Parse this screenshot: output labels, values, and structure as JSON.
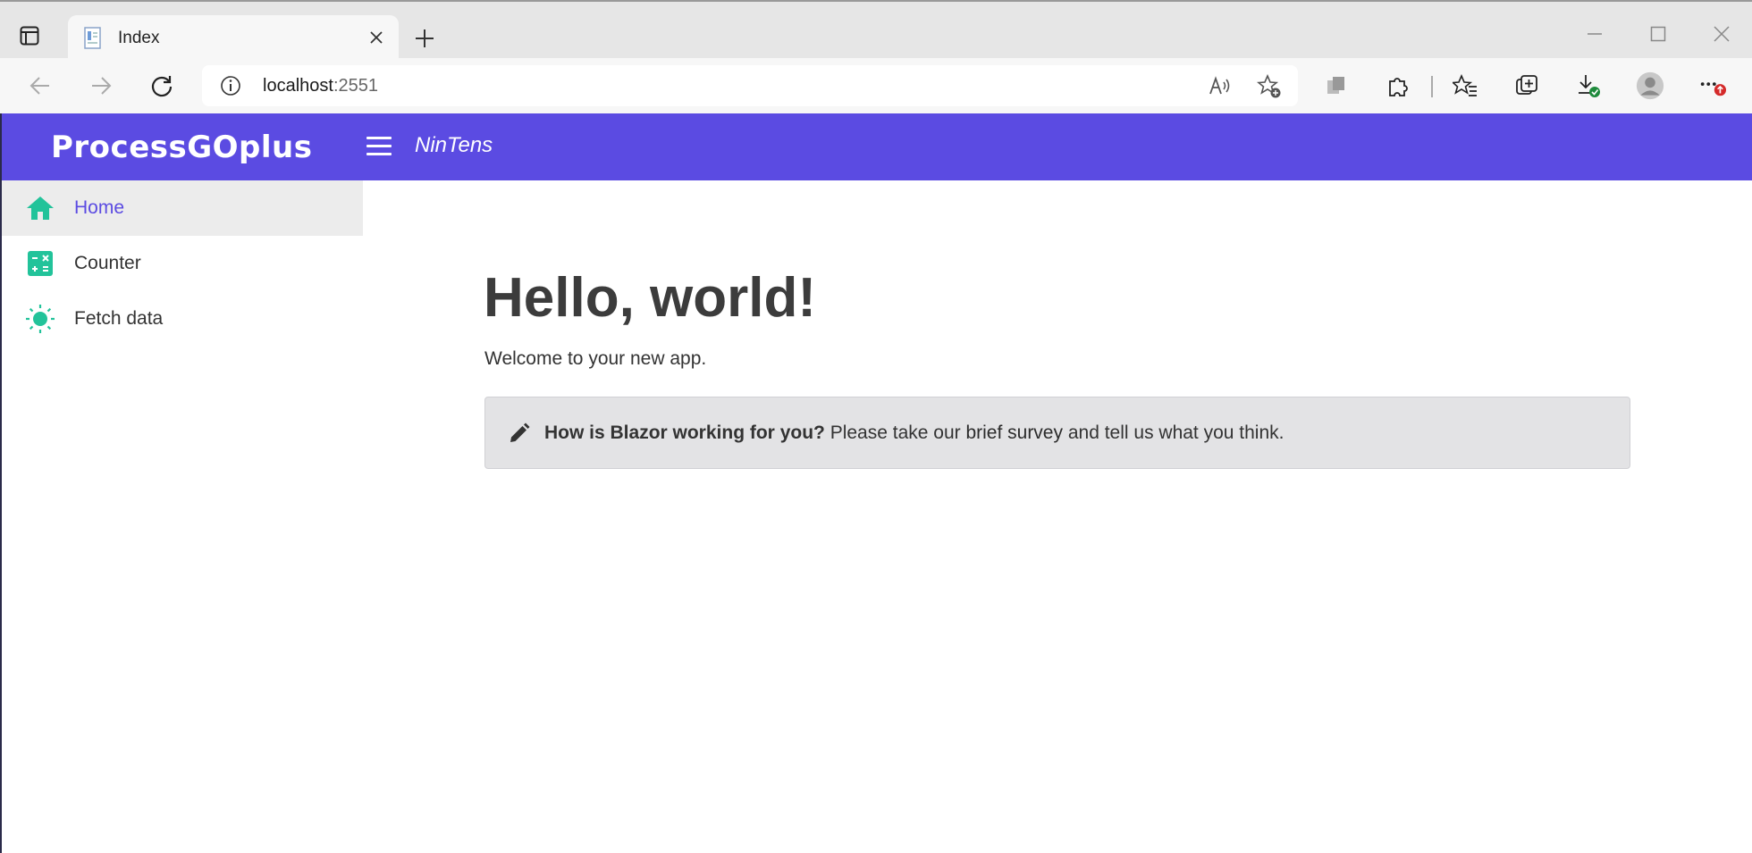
{
  "browser": {
    "tab": {
      "title": "Index"
    },
    "address": {
      "host": "localhost",
      "port": ":2551"
    }
  },
  "app": {
    "logo": "ProcessGOplus",
    "name": "NinTens",
    "accent_color": "#5b4be2",
    "icon_color": "#22c39a"
  },
  "sidebar": {
    "items": [
      {
        "label": "Home",
        "icon": "home-icon",
        "active": true
      },
      {
        "label": "Counter",
        "icon": "calculator-icon",
        "active": false
      },
      {
        "label": "Fetch data",
        "icon": "sun-icon",
        "active": false
      }
    ]
  },
  "main": {
    "title": "Hello, world!",
    "welcome": "Welcome to your new app.",
    "survey": {
      "question": "How is Blazor working for you?",
      "pre_link": " Please take our ",
      "link": "brief survey",
      "post_link": " and tell us what you think."
    }
  }
}
